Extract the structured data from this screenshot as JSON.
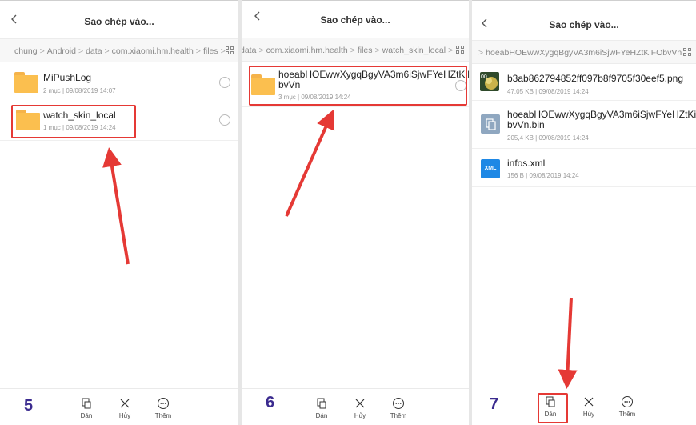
{
  "title": "Sao chép vào...",
  "panels": [
    {
      "breadcrumb": [
        "chung",
        "Android",
        "data",
        "com.xiaomi.hm.health",
        "files"
      ],
      "items": [
        {
          "name": "MiPushLog",
          "count": "2 mục",
          "date": "09/08/2019 14:07"
        },
        {
          "name": "watch_skin_local",
          "count": "1 mục",
          "date": "09/08/2019 14:24"
        }
      ],
      "step": "5"
    },
    {
      "breadcrumb": [
        "data",
        "com.xiaomi.hm.health",
        "files",
        "watch_skin_local"
      ],
      "items": [
        {
          "name_line1": "hoeabHOEwwXygqBgyVA3m6iSjwFYeHZtKiFO",
          "name_line2": "bvVn",
          "count": "3 mục",
          "date": "09/08/2019 14:24"
        }
      ],
      "step": "6"
    },
    {
      "breadcrumb": [
        "hoeabHOEwwXygqBgyVA3m6iSjwFYeHZtKiFObvVn"
      ],
      "items": [
        {
          "name": "b3ab862794852ff097b8f9705f30eef5.png",
          "size": "47,05 KB",
          "date": "09/08/2019 14:24"
        },
        {
          "name_line1": "hoeabHOEwwXygqBgyVA3m6iSjwFYeHZtKiFO",
          "name_line2": "bvVn.bin",
          "size": "205,4 KB",
          "date": "09/08/2019 14:24"
        },
        {
          "name": "infos.xml",
          "size": "156 B",
          "date": "09/08/2019 14:24",
          "icon_text": "XML"
        }
      ],
      "step": "7"
    }
  ],
  "toolbar": {
    "paste": "Dán",
    "cancel": "Hủy",
    "more": "Thêm"
  },
  "colors": {
    "accent": "#3b2b8f",
    "highlight": "#e53935",
    "folder": "#fbbf4f"
  }
}
